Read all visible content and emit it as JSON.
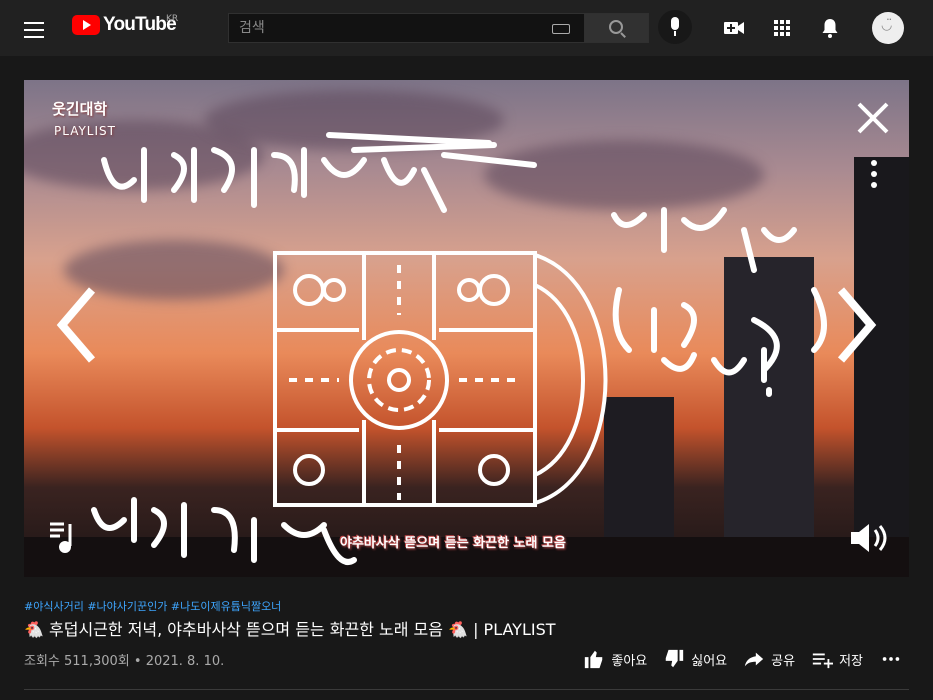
{
  "header": {
    "logo_text": "YouTube",
    "logo_region": "KR",
    "search_placeholder": "검색"
  },
  "video": {
    "overlay_brand": "웃긴대학",
    "overlay_playlist": "PLAYLIST",
    "subtitle": "야추바사삭 뜯으며 듣는 화끈한 노래 모음",
    "scribble_main": "넘시감 펀달철",
    "scribble_side": "또내 최강 (미녀 최고!)",
    "scribble_bottom": "넘시김 펀달철"
  },
  "meta": {
    "hashtags": [
      "#야식사거리",
      "#나야사기꾼인가",
      "#나도이제유튭닉짤오너"
    ],
    "title": "🐔 후덥시근한 저녁, 야추바사삭 뜯으며 듣는 화끈한 노래 모음 🐔 | PLAYLIST",
    "views": "조회수 511,300회",
    "date": "2021. 8. 10."
  },
  "actions": {
    "like": "좋아요",
    "dislike": "싫어요",
    "share": "공유",
    "save": "저장"
  }
}
